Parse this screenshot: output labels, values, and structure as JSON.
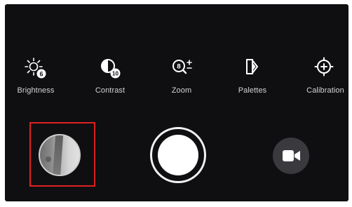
{
  "toolbar": {
    "items": [
      {
        "label": "Brightness",
        "icon": "brightness-icon",
        "badge": "6"
      },
      {
        "label": "Contrast",
        "icon": "contrast-icon",
        "badge": "10"
      },
      {
        "label": "Zoom",
        "icon": "zoom-icon",
        "badge": "8"
      },
      {
        "label": "Palettes",
        "icon": "palettes-icon"
      },
      {
        "label": "Calibration",
        "icon": "calibration-icon"
      }
    ]
  },
  "capture": {
    "gallery_icon": "gallery-thumbnail",
    "shutter_icon": "shutter-button",
    "record_icon": "video-camera-icon"
  },
  "colors": {
    "background": "#0f0f12",
    "highlight": "#e02020",
    "foreground": "#ffffff"
  }
}
